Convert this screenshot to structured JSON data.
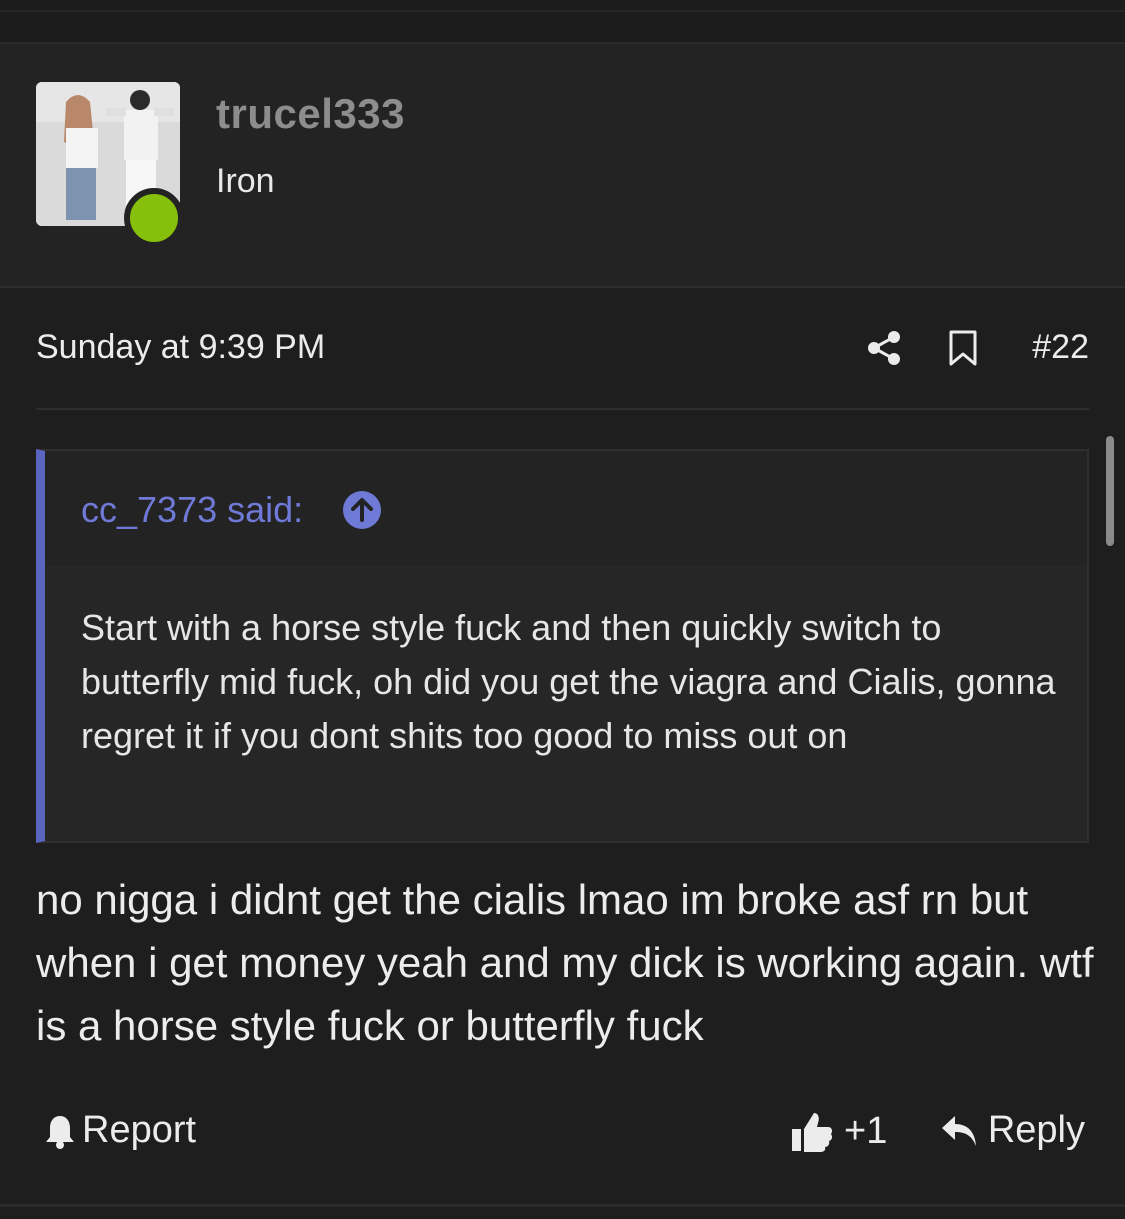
{
  "user": {
    "name": "trucel333",
    "title": "Iron",
    "status_color": "#86bf0c"
  },
  "post": {
    "timestamp": "Sunday at 9:39 PM",
    "number": "#22",
    "share_icon": "share-icon",
    "bookmark_icon": "bookmark-icon",
    "body": "no nigga i didnt get the cialis lmao im broke asf rn but when i get money yeah and my dick is working again. wtf is a horse style fuck or butterfly fuck"
  },
  "quote": {
    "author": "cc_7373 said:",
    "body": "Start with a horse style fuck and then quickly switch to butterfly mid fuck, oh did you get the viagra and Cialis, gonna regret it if you dont shits too good to miss out on",
    "accent_color": "#5a65bf"
  },
  "actions": {
    "report_label": "Report",
    "like_count": "+1",
    "reply_label": "Reply"
  }
}
